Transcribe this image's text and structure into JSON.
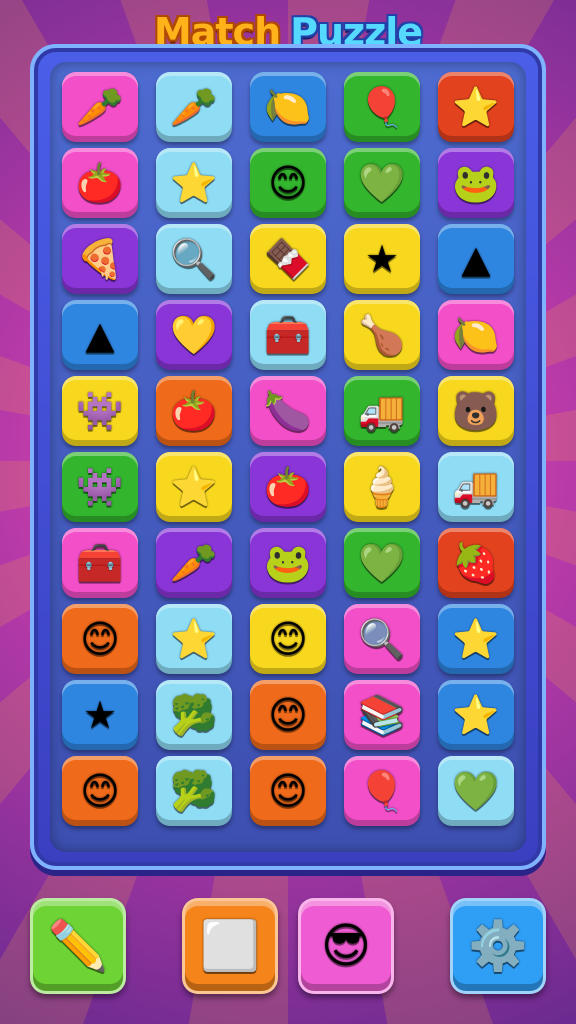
{
  "header": {
    "title_word1": "Match",
    "title_word2": "Puzzle"
  },
  "colors": {
    "pink": "#f24fc8",
    "lightblue": "#8fdcf5",
    "blue": "#2f86e0",
    "green": "#33b52e",
    "orange": "#ef6a1a",
    "purple": "#8a35d8",
    "yellow": "#f8d81e",
    "red": "#e2421e"
  },
  "grid": {
    "rows": [
      [
        {
          "color": "pink",
          "icon": "carrot-icon",
          "glyph": "🥕"
        },
        {
          "color": "lightblue",
          "icon": "carrot-icon",
          "glyph": "🥕"
        },
        {
          "color": "blue",
          "icon": "lemon-icon",
          "glyph": "🍋"
        },
        {
          "color": "green",
          "icon": "balloon-icon",
          "glyph": "🎈"
        },
        {
          "color": "red",
          "icon": "star-icon",
          "glyph": "⭐"
        }
      ],
      [
        {
          "color": "pink",
          "icon": "tomato-icon",
          "glyph": "🍅"
        },
        {
          "color": "lightblue",
          "icon": "star-icon",
          "glyph": "⭐"
        },
        {
          "color": "green",
          "icon": "smiley-face-icon",
          "glyph": "😊"
        },
        {
          "color": "green",
          "icon": "heart-icon",
          "glyph": "💚"
        },
        {
          "color": "purple",
          "icon": "frog-icon",
          "glyph": "🐸"
        }
      ],
      [
        {
          "color": "purple",
          "icon": "pizza-icon",
          "glyph": "🍕"
        },
        {
          "color": "lightblue",
          "icon": "magnifier-icon",
          "glyph": "🔍"
        },
        {
          "color": "yellow",
          "icon": "chocolate-bar-icon",
          "glyph": "🍫"
        },
        {
          "color": "yellow",
          "icon": "star-icon",
          "glyph": "★"
        },
        {
          "color": "blue",
          "icon": "pyramid-icon",
          "glyph": "▲"
        }
      ],
      [
        {
          "color": "blue",
          "icon": "pyramid-icon",
          "glyph": "▲"
        },
        {
          "color": "purple",
          "icon": "heart-icon",
          "glyph": "💛"
        },
        {
          "color": "lightblue",
          "icon": "toolbox-icon",
          "glyph": "🧰"
        },
        {
          "color": "yellow",
          "icon": "drumstick-icon",
          "glyph": "🍗"
        },
        {
          "color": "pink",
          "icon": "lemon-icon",
          "glyph": "🍋"
        }
      ],
      [
        {
          "color": "yellow",
          "icon": "monster-face-icon",
          "glyph": "👾"
        },
        {
          "color": "orange",
          "icon": "tomato-icon",
          "glyph": "🍅"
        },
        {
          "color": "pink",
          "icon": "eggplant-icon",
          "glyph": "🍆"
        },
        {
          "color": "green",
          "icon": "truck-icon",
          "glyph": "🚚"
        },
        {
          "color": "yellow",
          "icon": "bear-face-icon",
          "glyph": "🐻"
        }
      ],
      [
        {
          "color": "green",
          "icon": "monster-face-icon",
          "glyph": "👾"
        },
        {
          "color": "yellow",
          "icon": "star-icon",
          "glyph": "⭐"
        },
        {
          "color": "purple",
          "icon": "tomato-icon",
          "glyph": "🍅"
        },
        {
          "color": "yellow",
          "icon": "ice-cream-cone-icon",
          "glyph": "🍦"
        },
        {
          "color": "lightblue",
          "icon": "truck-icon",
          "glyph": "🚚"
        }
      ],
      [
        {
          "color": "pink",
          "icon": "toolbox-icon",
          "glyph": "🧰"
        },
        {
          "color": "purple",
          "icon": "carrot-icon",
          "glyph": "🥕"
        },
        {
          "color": "purple",
          "icon": "frog-icon",
          "glyph": "🐸"
        },
        {
          "color": "green",
          "icon": "heart-icon",
          "glyph": "💚"
        },
        {
          "color": "red",
          "icon": "strawberry-icon",
          "glyph": "🍓"
        }
      ],
      [
        {
          "color": "orange",
          "icon": "smiley-face-icon",
          "glyph": "😊"
        },
        {
          "color": "lightblue",
          "icon": "star-icon",
          "glyph": "⭐"
        },
        {
          "color": "yellow",
          "icon": "smiley-face-icon",
          "glyph": "😊"
        },
        {
          "color": "pink",
          "icon": "magnifier-icon",
          "glyph": "🔍"
        },
        {
          "color": "blue",
          "icon": "star-icon",
          "glyph": "⭐"
        }
      ],
      [
        {
          "color": "blue",
          "icon": "star-icon",
          "glyph": "★"
        },
        {
          "color": "lightblue",
          "icon": "broccoli-icon",
          "glyph": "🥦"
        },
        {
          "color": "orange",
          "icon": "smiley-face-icon",
          "glyph": "😊"
        },
        {
          "color": "pink",
          "icon": "books-icon",
          "glyph": "📚"
        },
        {
          "color": "blue",
          "icon": "star-icon",
          "glyph": "⭐"
        }
      ],
      [
        {
          "color": "orange",
          "icon": "smiley-face-icon",
          "glyph": "😊"
        },
        {
          "color": "lightblue",
          "icon": "broccoli-icon",
          "glyph": "🥦"
        },
        {
          "color": "orange",
          "icon": "smiley-face-icon",
          "glyph": "😊"
        },
        {
          "color": "pink",
          "icon": "balloon-icon",
          "glyph": "🎈"
        },
        {
          "color": "lightblue",
          "icon": "heart-icon",
          "glyph": "💚"
        }
      ]
    ]
  },
  "toolbar": {
    "buttons": [
      {
        "name": "pencil-button",
        "icon": "pencil-icon",
        "glyph": "✏️",
        "color": "#6ed334"
      },
      {
        "name": "block-button",
        "icon": "cube-icon",
        "glyph": "⬜",
        "color": "#f5841a"
      },
      {
        "name": "character-button",
        "icon": "character-icon",
        "glyph": "😎",
        "color": "#ef5bd2"
      },
      {
        "name": "settings-button",
        "icon": "gear-icon",
        "glyph": "⚙️",
        "color": "#2f9ef5"
      }
    ]
  }
}
